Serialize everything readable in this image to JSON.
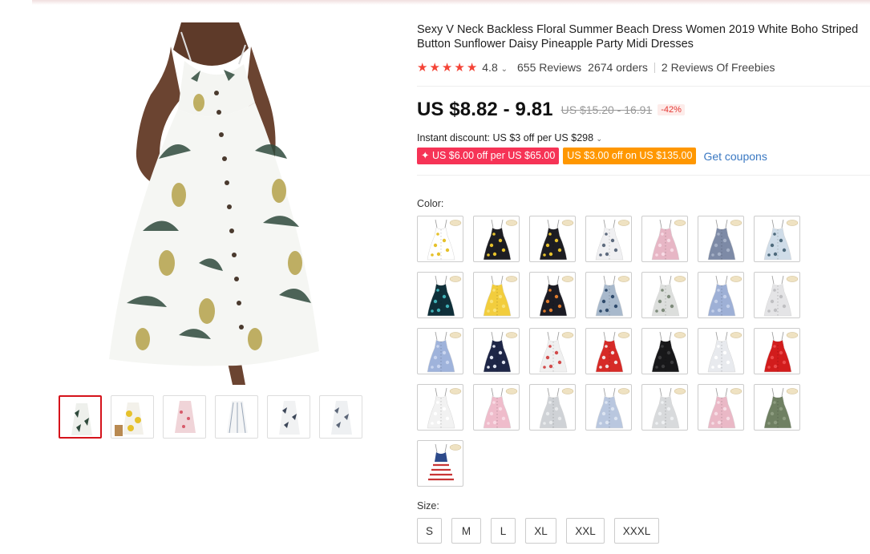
{
  "product": {
    "title": "Sexy V Neck Backless Floral Summer Beach Dress Women 2019 White Boho Striped Button Sunflower Daisy Pineapple Party Midi Dresses",
    "rating": "4.8",
    "stars": 5,
    "reviews": "655 Reviews",
    "orders": "2674 orders",
    "freebies": "2 Reviews Of Freebies"
  },
  "price": {
    "current": "US $8.82 - 9.81",
    "original": "US $15.20 - 16.91",
    "discount": "-42%"
  },
  "promo": {
    "instant": "Instant discount: US $3 off per US $298",
    "coupon_1": "✦ US $6.00 off per US $65.00",
    "coupon_2": "US $3.00 off on US $135.00",
    "get_coupons": "Get coupons"
  },
  "options": {
    "color_label": "Color:",
    "size_label": "Size:",
    "sizes": [
      "S",
      "M",
      "L",
      "XL",
      "XXL",
      "XXXL"
    ]
  },
  "gallery": {
    "thumbnails": [
      "white-pineapple",
      "yellow-sunflower",
      "pink-floral",
      "white-striped",
      "navy-leaf",
      "grey-leaf"
    ],
    "selected": 0
  },
  "colors": {
    "brand_red": "#d5131b",
    "coupon_red": "#f63356",
    "coupon_orange": "#ff9700",
    "star": "#f44336",
    "link": "#3a78c2"
  },
  "swatches": [
    {
      "base": "#fff",
      "pattern": "#e6c12b"
    },
    {
      "base": "#1d1d22",
      "pattern": "#e6c12b"
    },
    {
      "base": "#1d1d22",
      "pattern": "#e6c12b"
    },
    {
      "base": "#f0f0f2",
      "pattern": "#5e6b7e"
    },
    {
      "base": "#e7b6c5",
      "pattern": "#f7dbe5"
    },
    {
      "base": "#7d8aa6",
      "pattern": "#a5b0c6"
    },
    {
      "base": "#cfdce8",
      "pattern": "#4e6a7c"
    },
    {
      "base": "#0f2f39",
      "pattern": "#3fb0b6"
    },
    {
      "base": "#f2cd3d",
      "pattern": "#f8e27a"
    },
    {
      "base": "#1c1c24",
      "pattern": "#e07b2c"
    },
    {
      "base": "#a8b9cc",
      "pattern": "#2e4a6b"
    },
    {
      "base": "#dcdedc",
      "pattern": "#7d8a7a"
    },
    {
      "base": "#9eb0d6",
      "pattern": "#c4d0ea"
    },
    {
      "base": "#e4e4e6",
      "pattern": "#bfbfc2"
    },
    {
      "base": "#9fb3db",
      "pattern": "#c9d5ef"
    },
    {
      "base": "#1e2647",
      "pattern": "#dfe3ef"
    },
    {
      "base": "#f0f0f0",
      "pattern": "#d24a4a"
    },
    {
      "base": "#d62a27",
      "pattern": "#f0dede"
    },
    {
      "base": "#18181a",
      "pattern": "#3a3a3c"
    },
    {
      "base": "#e8eaee",
      "pattern": "#ffffff"
    },
    {
      "base": "#d21c1c",
      "pattern": "#ea4a4a"
    },
    {
      "base": "#f2f2f2",
      "pattern": "#ffffff"
    },
    {
      "base": "#efbccb",
      "pattern": "#f8dbe4"
    },
    {
      "base": "#cfd2d6",
      "pattern": "#e8eaec"
    },
    {
      "base": "#b9c7df",
      "pattern": "#dce4f1"
    },
    {
      "base": "#d8dadc",
      "pattern": "#eef0f2"
    },
    {
      "base": "#eab8c6",
      "pattern": "#f6dce4"
    },
    {
      "base": "#6f8062",
      "pattern": "#8d9c80"
    },
    {
      "base": "#c83535",
      "pattern": "#ffffff"
    }
  ]
}
